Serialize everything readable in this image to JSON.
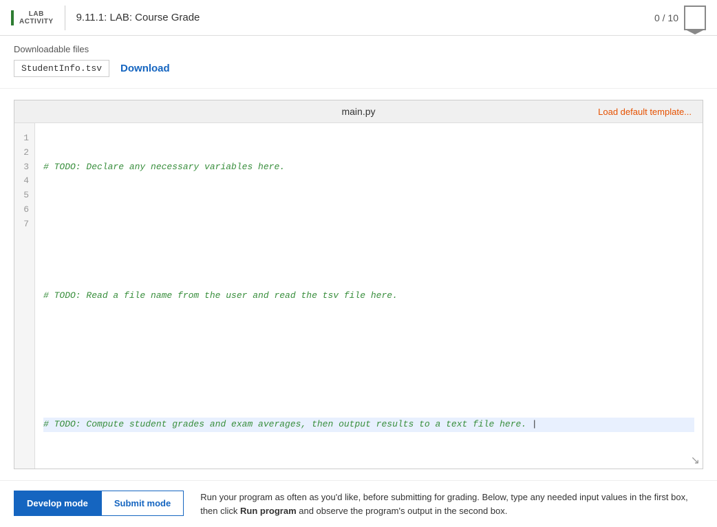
{
  "header": {
    "lab_line1": "LAB",
    "lab_line2": "ACTIVITY",
    "title": "9.11.1: LAB: Course Grade",
    "score": "0 / 10"
  },
  "downloadable": {
    "section_label": "Downloadable files",
    "file_name": "StudentInfo.tsv",
    "download_label": "Download"
  },
  "editor": {
    "filename": "main.py",
    "load_template_label": "Load default template...",
    "lines": [
      {
        "number": "1",
        "code": "# TODO: Declare any necessary variables here.",
        "active": false
      },
      {
        "number": "2",
        "code": "",
        "active": false
      },
      {
        "number": "3",
        "code": "",
        "active": false
      },
      {
        "number": "4",
        "code": "# TODO: Read a file name from the user and read the tsv file here.",
        "active": false
      },
      {
        "number": "5",
        "code": "",
        "active": false
      },
      {
        "number": "6",
        "code": "",
        "active": false
      },
      {
        "number": "7",
        "code": "# TODO: Compute student grades and exam averages, then output results to a text file here.",
        "active": true
      }
    ]
  },
  "bottom": {
    "develop_mode_label": "Develop mode",
    "submit_mode_label": "Submit mode",
    "instructions": "Run your program as often as you'd like, before submitting for grading. Below, type any needed input values in the first box, then click ",
    "run_program_label": "Run program",
    "instructions_end": " and observe the program's output in the second box."
  }
}
